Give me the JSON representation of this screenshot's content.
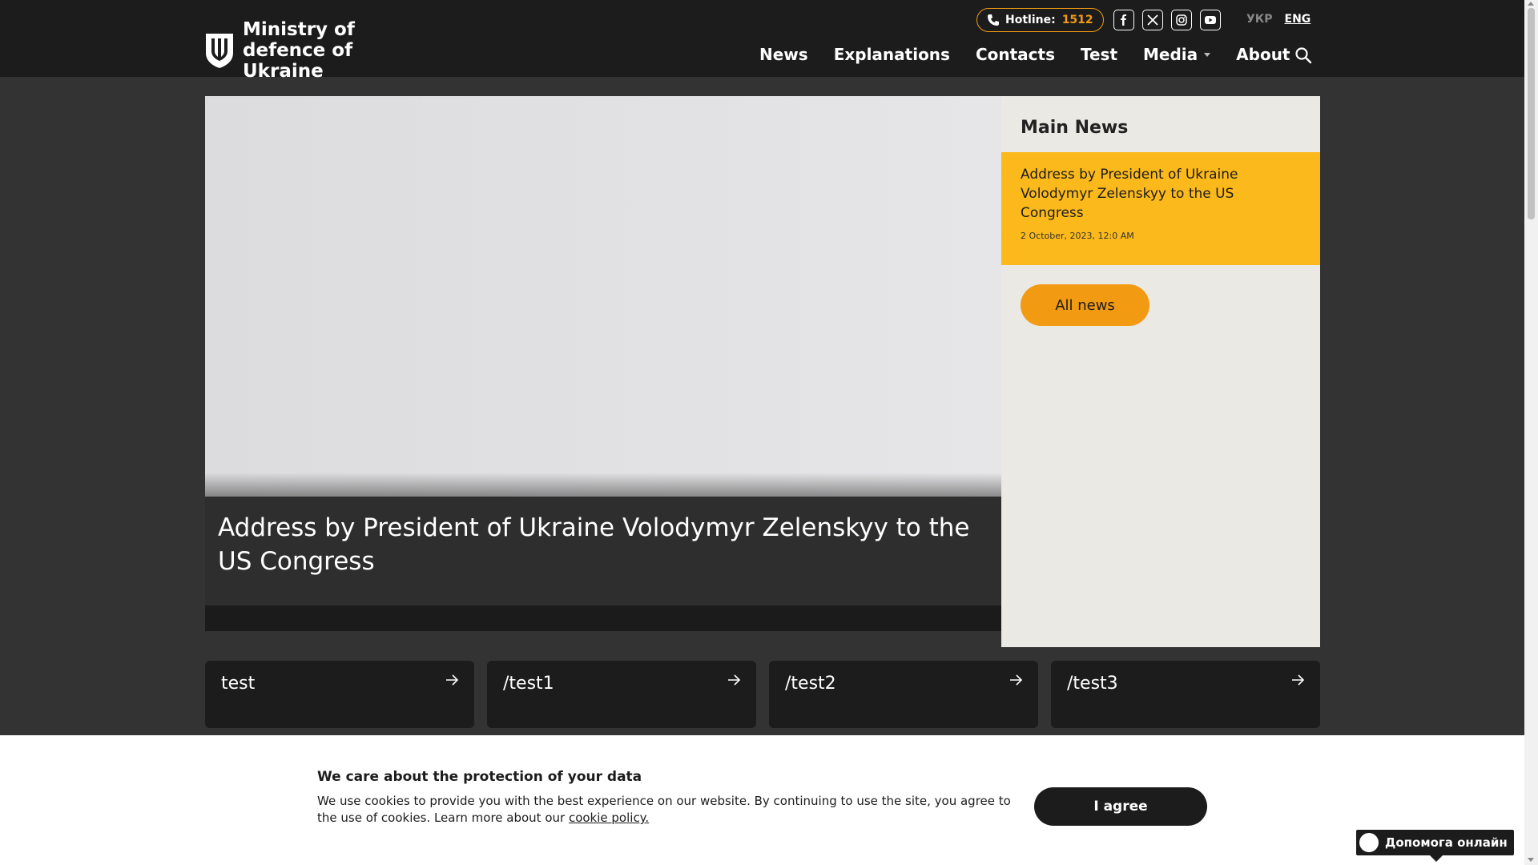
{
  "header": {
    "logo_line1": "Ministry of",
    "logo_line2": "defence of Ukraine",
    "hotline_label": "Hotline:",
    "hotline_number": "1512",
    "socials": [
      "facebook-icon",
      "x-twitter-icon",
      "instagram-icon",
      "youtube-icon"
    ],
    "lang_ukr": "УКР",
    "lang_eng": "ENG",
    "nav": {
      "news": "News",
      "explanations": "Explanations",
      "contacts": "Contacts",
      "test": "Test",
      "media": "Media",
      "about": "About"
    }
  },
  "hero": {
    "title": "Address by President of Ukraine Volodymyr Zelenskyy to the US Congress"
  },
  "sidebar": {
    "title": "Main News",
    "item_title": "Address by President of Ukraine Volodymyr Zelenskyy to the US Congress",
    "item_date": "2 October, 2023, 12:0 AM",
    "all_news": "All news"
  },
  "cards": [
    "test",
    "/test1",
    "/test2",
    "/test3"
  ],
  "cookie": {
    "title": "We care about the protection of your data",
    "text": "We use cookies to provide you with the best experience on our website. By continuing to use the site, you agree to the use of cookies. Learn more about our ",
    "link": "cookie policy.",
    "button": "I agree"
  },
  "help": {
    "label": "Допомога онлайн"
  },
  "colors": {
    "header_bg": "#1c1c1c",
    "page_bg": "#333333",
    "accent_yellow": "#fcb91b",
    "accent_orange": "#f29a12",
    "sidebar_bg": "#ebe9e4"
  }
}
